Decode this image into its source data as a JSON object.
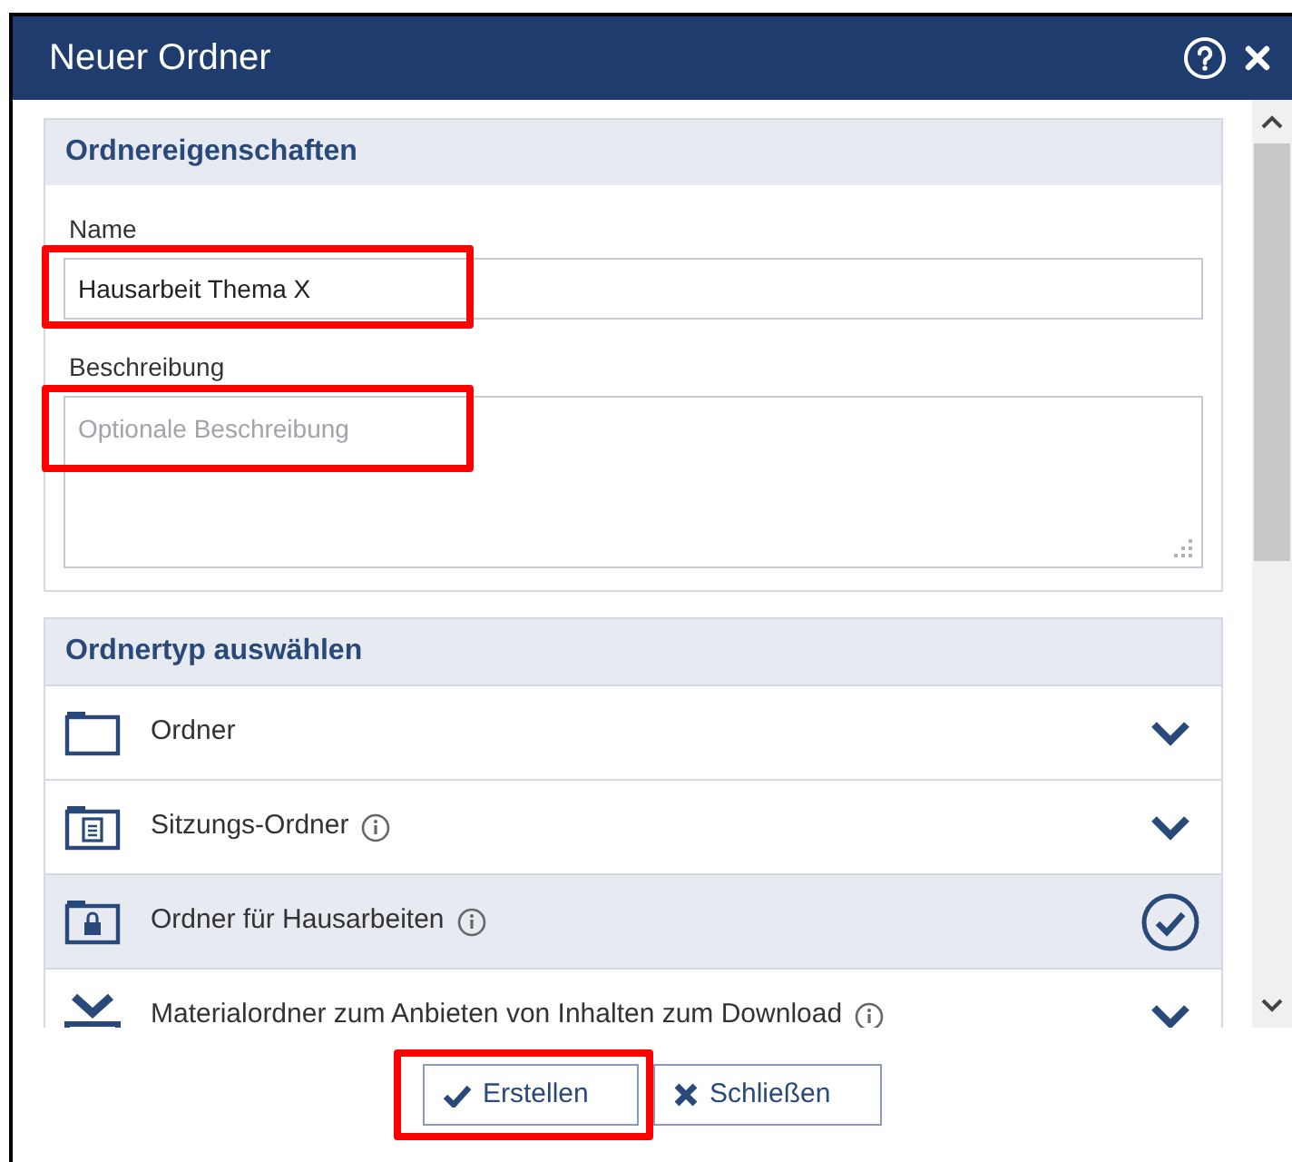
{
  "window": {
    "title": "Neuer Ordner"
  },
  "properties": {
    "heading": "Ordnereigenschaften",
    "name": {
      "label": "Name",
      "value": "Hausarbeit Thema X",
      "highlighted": true
    },
    "description": {
      "label": "Beschreibung",
      "placeholder": "Optionale Beschreibung",
      "highlighted": true
    }
  },
  "folder_types": {
    "heading": "Ordnertyp auswählen",
    "items": [
      {
        "kind": "folder",
        "label": "Ordner",
        "info": false,
        "selected": false
      },
      {
        "kind": "meeting",
        "label": "Sitzungs-Ordner",
        "info": true,
        "selected": false
      },
      {
        "kind": "locked",
        "label": "Ordner für Hausarbeiten",
        "info": true,
        "selected": true
      },
      {
        "kind": "material",
        "label": "Materialordner zum Anbieten von Inhalten zum Download",
        "info": true,
        "selected": false
      }
    ]
  },
  "buttons": [
    {
      "kind": "create",
      "label": "Erstellen",
      "highlighted": true
    },
    {
      "kind": "close",
      "label": "Schließen",
      "highlighted": false
    }
  ]
}
